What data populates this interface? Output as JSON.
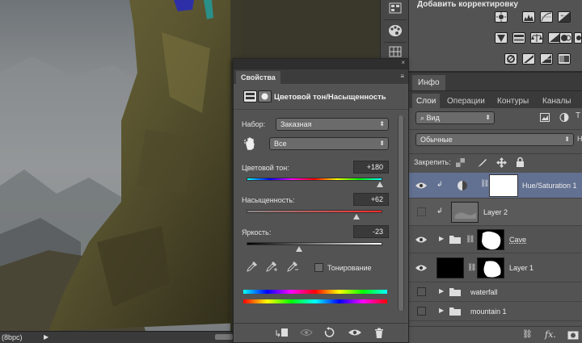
{
  "canvas": {
    "status_text": "(8bpc)",
    "status_arrow": "▶"
  },
  "toolstrip": {
    "tools": [
      "swatches-icon",
      "color-palette-icon",
      "grid-icon"
    ]
  },
  "adjustments": {
    "title": "Добавить корректировку"
  },
  "info_panel": {
    "tab_label": "Инфо"
  },
  "layers_panel": {
    "tabs": [
      "Слои",
      "Операции",
      "Контуры",
      "Каналы"
    ],
    "filter_value": "Вид",
    "blend_mode": "Обычные",
    "opacity_short": "Н",
    "lock_label": "Закрепить:",
    "layers": [
      {
        "name": "Hue/Saturation 1",
        "visible": true,
        "selected": true
      },
      {
        "name": "Layer 2",
        "visible": false,
        "selected": false
      },
      {
        "name": "Cave",
        "visible": true,
        "selected": false
      },
      {
        "name": "Layer 1",
        "visible": true,
        "selected": false
      },
      {
        "name": "waterfall",
        "visible": false,
        "selected": false
      },
      {
        "name": "mountain 1",
        "visible": false,
        "selected": false
      }
    ],
    "footer_fx": "fx."
  },
  "properties": {
    "tab_label": "Свойства",
    "close_symbol": "×",
    "menu_symbol": "≡",
    "header_title": "Цветовой тон/Насыщенность",
    "preset_label": "Набор:",
    "preset_value": "Заказная",
    "channel_value": "Все",
    "hue_label": "Цветовой тон:",
    "hue_value": "+180",
    "saturation_label": "Насыщенность:",
    "saturation_value": "+62",
    "lightness_label": "Яркость:",
    "lightness_value": "-23",
    "colorize_label": "Тонирование",
    "colorize_checked": false,
    "hue_level": 0.98,
    "saturation_level": 0.81,
    "lightness_level": 0.385
  },
  "colors": {
    "panel_bg": "#535353",
    "selected_layer": "#627091",
    "dark_bg": "#2b2b2b"
  }
}
